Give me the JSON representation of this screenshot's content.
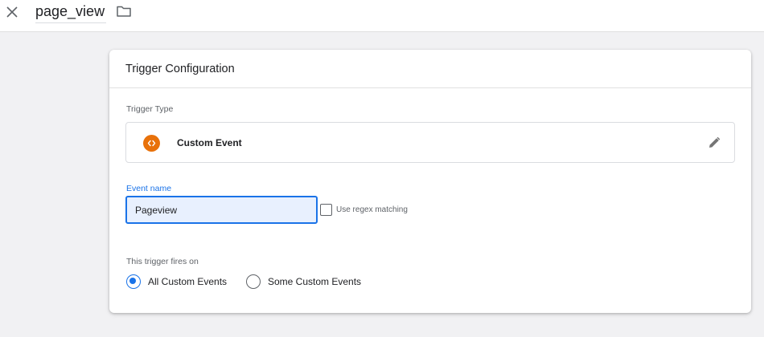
{
  "header": {
    "title": "page_view"
  },
  "card": {
    "title": "Trigger Configuration",
    "trigger_type_label": "Trigger Type",
    "trigger_type": {
      "name": "Custom Event",
      "icon": "code-brackets-icon",
      "icon_color": "#e8710a"
    },
    "event_name": {
      "label": "Event name",
      "value": "Pageview"
    },
    "regex_option": {
      "label": "Use regex matching",
      "checked": false
    },
    "fires_on": {
      "label": "This trigger fires on",
      "options": [
        {
          "label": "All Custom Events",
          "selected": true
        },
        {
          "label": "Some Custom Events",
          "selected": false
        }
      ]
    }
  },
  "colors": {
    "accent": "#1a73e8",
    "input_fill": "#e8f0fe",
    "background": "#f1f1f3"
  }
}
